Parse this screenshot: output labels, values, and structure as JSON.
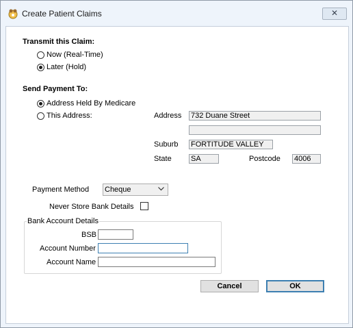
{
  "window": {
    "title": "Create Patient Claims",
    "close_glyph": "✕"
  },
  "transmit": {
    "heading": "Transmit this Claim:",
    "options": [
      {
        "label": "Now (Real-Time)",
        "selected": false
      },
      {
        "label": "Later (Hold)",
        "selected": true
      }
    ]
  },
  "payment_to": {
    "heading": "Send Payment To:",
    "options": [
      {
        "label": "Address Held By Medicare",
        "selected": true
      },
      {
        "label": "This Address:",
        "selected": false
      }
    ],
    "address_label": "Address",
    "address_line1": "732 Duane Street",
    "address_line2": "",
    "suburb_label": "Suburb",
    "suburb": "FORTITUDE VALLEY",
    "state_label": "State",
    "state": "SA",
    "postcode_label": "Postcode",
    "postcode": "4006"
  },
  "payment_method": {
    "label": "Payment Method",
    "value": "Cheque",
    "icon": "chevron-down-icon"
  },
  "never_store": {
    "label": "Never Store Bank Details",
    "checked": false
  },
  "bank": {
    "legend": "Bank Account Details",
    "bsb_label": "BSB",
    "bsb": "",
    "account_number_label": "Account Number",
    "account_number": "",
    "account_name_label": "Account Name",
    "account_name": ""
  },
  "buttons": {
    "cancel": "Cancel",
    "ok": "OK"
  },
  "colors": {
    "focus_border": "#3c7fb1",
    "window_bg": "#eef4fb"
  }
}
